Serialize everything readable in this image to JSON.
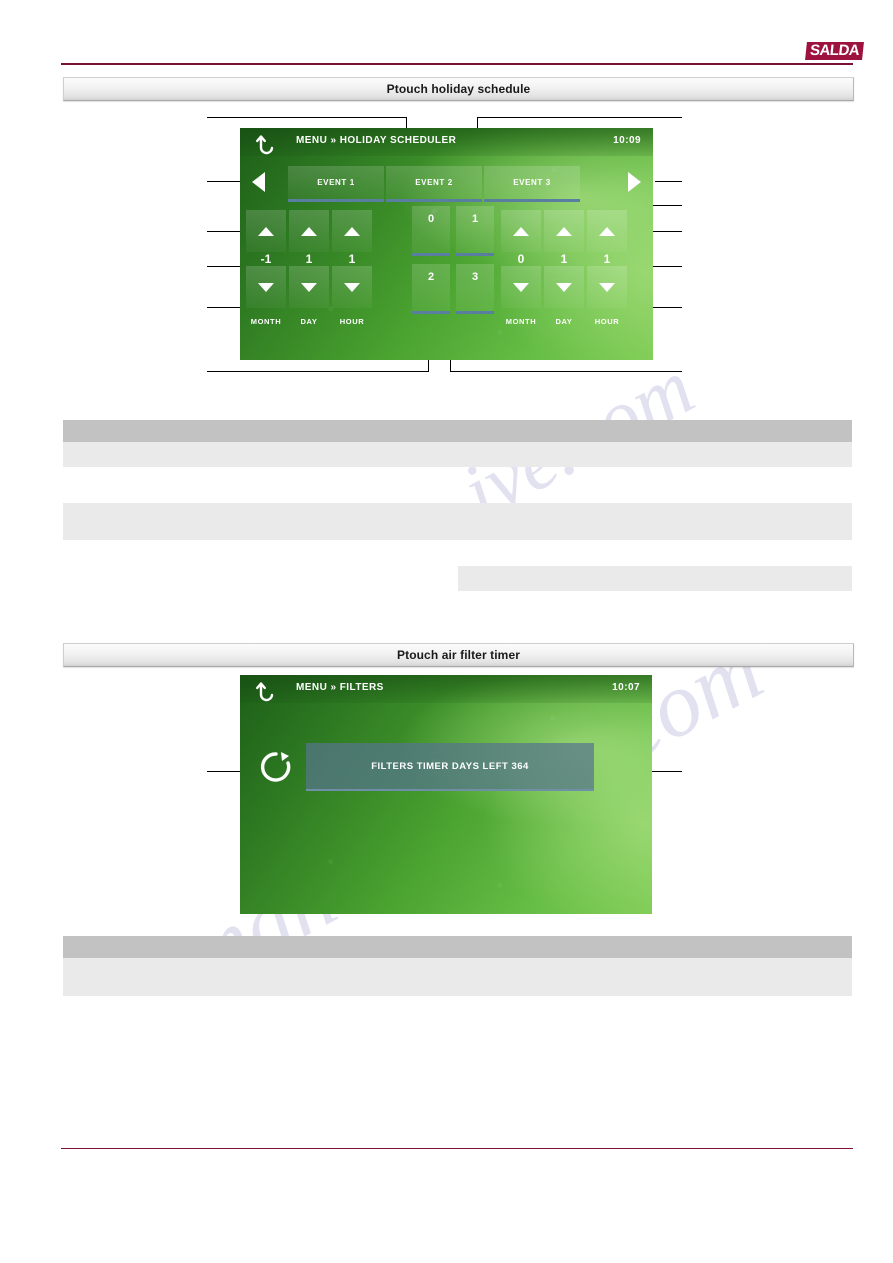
{
  "brand": {
    "logo_text": "SALDA"
  },
  "sections": [
    {
      "id": "holiday",
      "title": "Ptouch holiday schedule"
    },
    {
      "id": "filters",
      "title": "Ptouch air filter timer"
    }
  ],
  "watermark": {
    "line1": "manualshive.com",
    "line2": "ive.com"
  },
  "holiday_screen": {
    "back_icon": "back-arrow-icon",
    "title": "MENU » HOLIDAY SCHEDULER",
    "clock": "10:09",
    "nav_prev_icon": "triangle-left-icon",
    "nav_next_icon": "triangle-right-icon",
    "tabs": [
      {
        "label": "EVENT 1"
      },
      {
        "label": "EVENT 2"
      },
      {
        "label": "EVENT 3"
      }
    ],
    "start_group": {
      "columns": [
        {
          "unit": "MONTH",
          "value": "-1",
          "up_icon": "triangle-up-icon",
          "down_icon": "triangle-down-icon"
        },
        {
          "unit": "DAY",
          "value": "1",
          "up_icon": "triangle-up-icon",
          "down_icon": "triangle-down-icon"
        },
        {
          "unit": "HOUR",
          "value": "1",
          "up_icon": "triangle-up-icon",
          "down_icon": "triangle-down-icon"
        }
      ]
    },
    "stop_group": {
      "columns": [
        {
          "unit": "MONTH",
          "value": "0",
          "up_icon": "triangle-up-icon",
          "down_icon": "triangle-down-icon"
        },
        {
          "unit": "DAY",
          "value": "1",
          "up_icon": "triangle-up-icon",
          "down_icon": "triangle-down-icon"
        },
        {
          "unit": "HOUR",
          "value": "1",
          "up_icon": "triangle-up-icon",
          "down_icon": "triangle-down-icon"
        }
      ]
    },
    "center_cells": [
      {
        "value": "0"
      },
      {
        "value": "1"
      },
      {
        "value": "2"
      },
      {
        "value": "3"
      }
    ]
  },
  "filters_screen": {
    "back_icon": "back-arrow-icon",
    "title": "MENU » FILTERS",
    "clock": "10:07",
    "reset_icon": "refresh-icon",
    "status_text": "FILTERS TIMER DAYS LEFT 364"
  },
  "colors": {
    "brand": "#9e1240",
    "rule": "#7c1038",
    "screen_green": "#49a12f",
    "tab_underline": "#5a7ea0",
    "status_bar": "#56748c",
    "band_dark": "#c2c2c2",
    "band_light": "#eaeaea"
  }
}
